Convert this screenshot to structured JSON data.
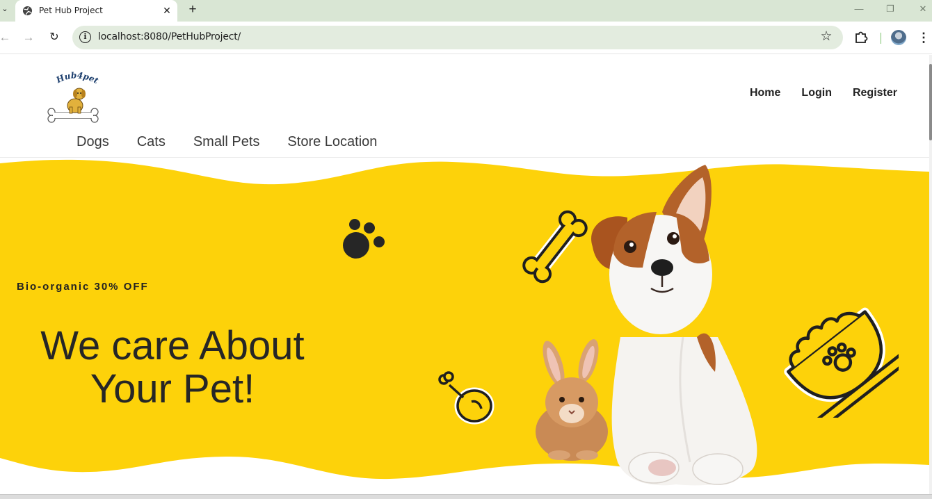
{
  "browser": {
    "tab_title": "Pet Hub Project",
    "url": "localhost:8080/PetHubProject/"
  },
  "site": {
    "logo_text": "Hub4pets",
    "main_nav": [
      {
        "label": "Home"
      },
      {
        "label": "Login"
      },
      {
        "label": "Register"
      }
    ],
    "category_nav": [
      {
        "label": "Dogs"
      },
      {
        "label": "Cats"
      },
      {
        "label": "Small Pets"
      },
      {
        "label": "Store Location"
      }
    ]
  },
  "hero": {
    "promo": "Bio-organic 30% OFF",
    "headline_line1": "We care About",
    "headline_line2": "Your Pet!"
  },
  "colors": {
    "hero_yellow": "#fdd20a",
    "text_dark": "#222222",
    "browser_tabbar": "#d9e6d4"
  },
  "icons": {
    "paw": "paw-icon",
    "bone": "bone-icon",
    "drumstick": "drumstick-icon",
    "food_bowl": "food-bowl-icon"
  }
}
